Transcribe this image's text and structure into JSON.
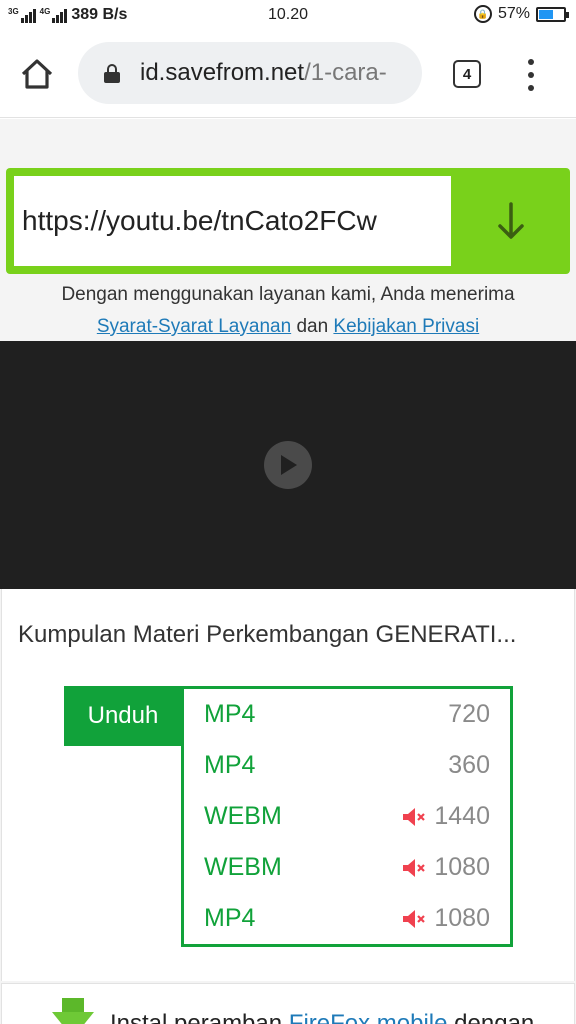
{
  "status_bar": {
    "net_speed": "389 B/s",
    "net_labels": [
      "3G",
      "4G"
    ],
    "time": "10.20",
    "battery": "57%",
    "battery_level": 0.57,
    "battery_color": "#2196f3"
  },
  "browser": {
    "url_host": "id.savefrom.net",
    "url_path": "/1-cara-",
    "tab_count": "4",
    "icons": [
      "home-icon",
      "padlock-icon",
      "tabs-icon",
      "overflow-menu-icon"
    ]
  },
  "form": {
    "input_value": "https://youtu.be/tnCato2FCw",
    "accent": "#79d11b"
  },
  "terms": {
    "prefix": "Dengan menggunakan layanan kami, Anda menerima",
    "link1": "Syarat-Syarat Layanan",
    "middle": "dan",
    "link2": "Kebijakan Privasi"
  },
  "video": {
    "title": "Kumpulan Materi Perkembangan GENERATI..."
  },
  "download": {
    "button_label": "Unduh",
    "brand_green": "#11a23a",
    "options": [
      {
        "format": "MP4",
        "resolution": "720",
        "muted": false
      },
      {
        "format": "MP4",
        "resolution": "360",
        "muted": false
      },
      {
        "format": "WEBM",
        "resolution": "1440",
        "muted": true
      },
      {
        "format": "WEBM",
        "resolution": "1080",
        "muted": true
      },
      {
        "format": "MP4",
        "resolution": "1080",
        "muted": true
      }
    ]
  },
  "promo": {
    "prefix": "Instal peramban",
    "link": "FireFox mobile",
    "suffix": "dengan"
  }
}
